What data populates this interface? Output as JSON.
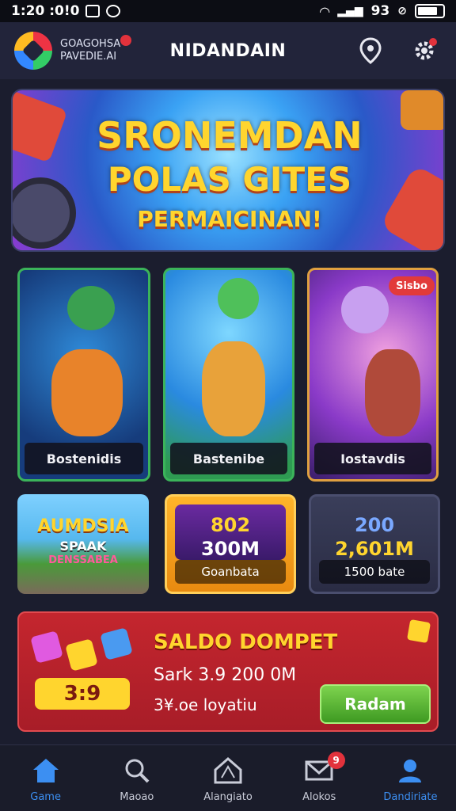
{
  "status_bar": {
    "time": "1:20 :0!0",
    "signal_text": "93"
  },
  "header": {
    "brand_line1": "GOAGOHSA",
    "brand_line2": "PAVEDIE.AI",
    "title": "NIDANDAIN",
    "icons": [
      "location-pin-icon",
      "gear-icon"
    ]
  },
  "banner": {
    "line1": "SRONEMDAN",
    "line2": "POLAS GITES",
    "line3": "PERMAICINAN!"
  },
  "games": [
    {
      "label": "Bostenidis",
      "accent": "#3bb35a"
    },
    {
      "label": "Bastenibe",
      "accent": "#3bb35a"
    },
    {
      "label": "Iostavdis",
      "accent": "#e0a040"
    }
  ],
  "game3_tag": "Sisbo",
  "tiles": [
    {
      "line1": "AUMDSIA",
      "line2": "SPAAK",
      "line3": "DENSSABEA"
    },
    {
      "line1": "802",
      "line2": "300M",
      "label": "Goanbata"
    },
    {
      "line1": "200",
      "line2": "2,601M",
      "label": "1500 bate"
    }
  ],
  "wallet": {
    "title": "SALDO DOMPET",
    "value": "Sark 3.9 200 0M",
    "detail": "3¥.oe loyatiu",
    "button": "Radam",
    "badge": "3:9"
  },
  "nav": {
    "items": [
      {
        "label": "Game",
        "icon": "home-icon"
      },
      {
        "label": "Maoao",
        "icon": "search-icon"
      },
      {
        "label": "Alangiato",
        "icon": "map-icon"
      },
      {
        "label": "Alokos",
        "icon": "mail-icon",
        "badge": "9"
      },
      {
        "label": "Dandiriate",
        "icon": "user-icon"
      }
    ]
  }
}
